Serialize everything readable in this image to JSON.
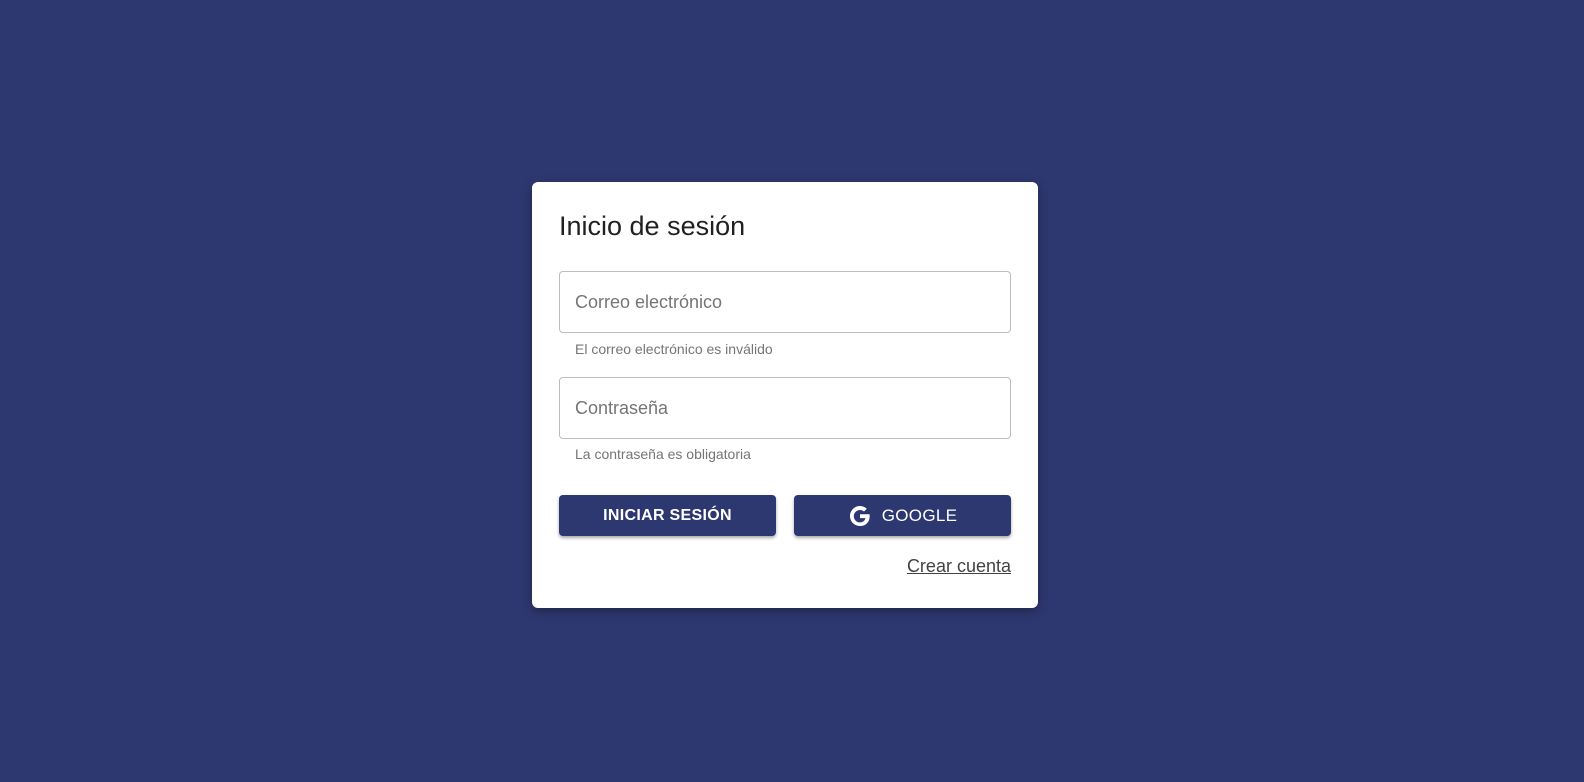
{
  "colors": {
    "background": "#2e3870",
    "card": "#ffffff",
    "button": "#2e3870",
    "button_text": "#ffffff"
  },
  "login": {
    "title": "Inicio de sesión",
    "email": {
      "value": "",
      "placeholder": "Correo electrónico",
      "helper": "El correo electrónico es inválido"
    },
    "password": {
      "value": "",
      "placeholder": "Contraseña",
      "helper": "La contraseña es obligatoria"
    },
    "submit_label": "INICIAR SESIÓN",
    "google": {
      "icon": "google-icon",
      "label": "GOOGLE"
    },
    "create_account_label": "Crear cuenta"
  }
}
